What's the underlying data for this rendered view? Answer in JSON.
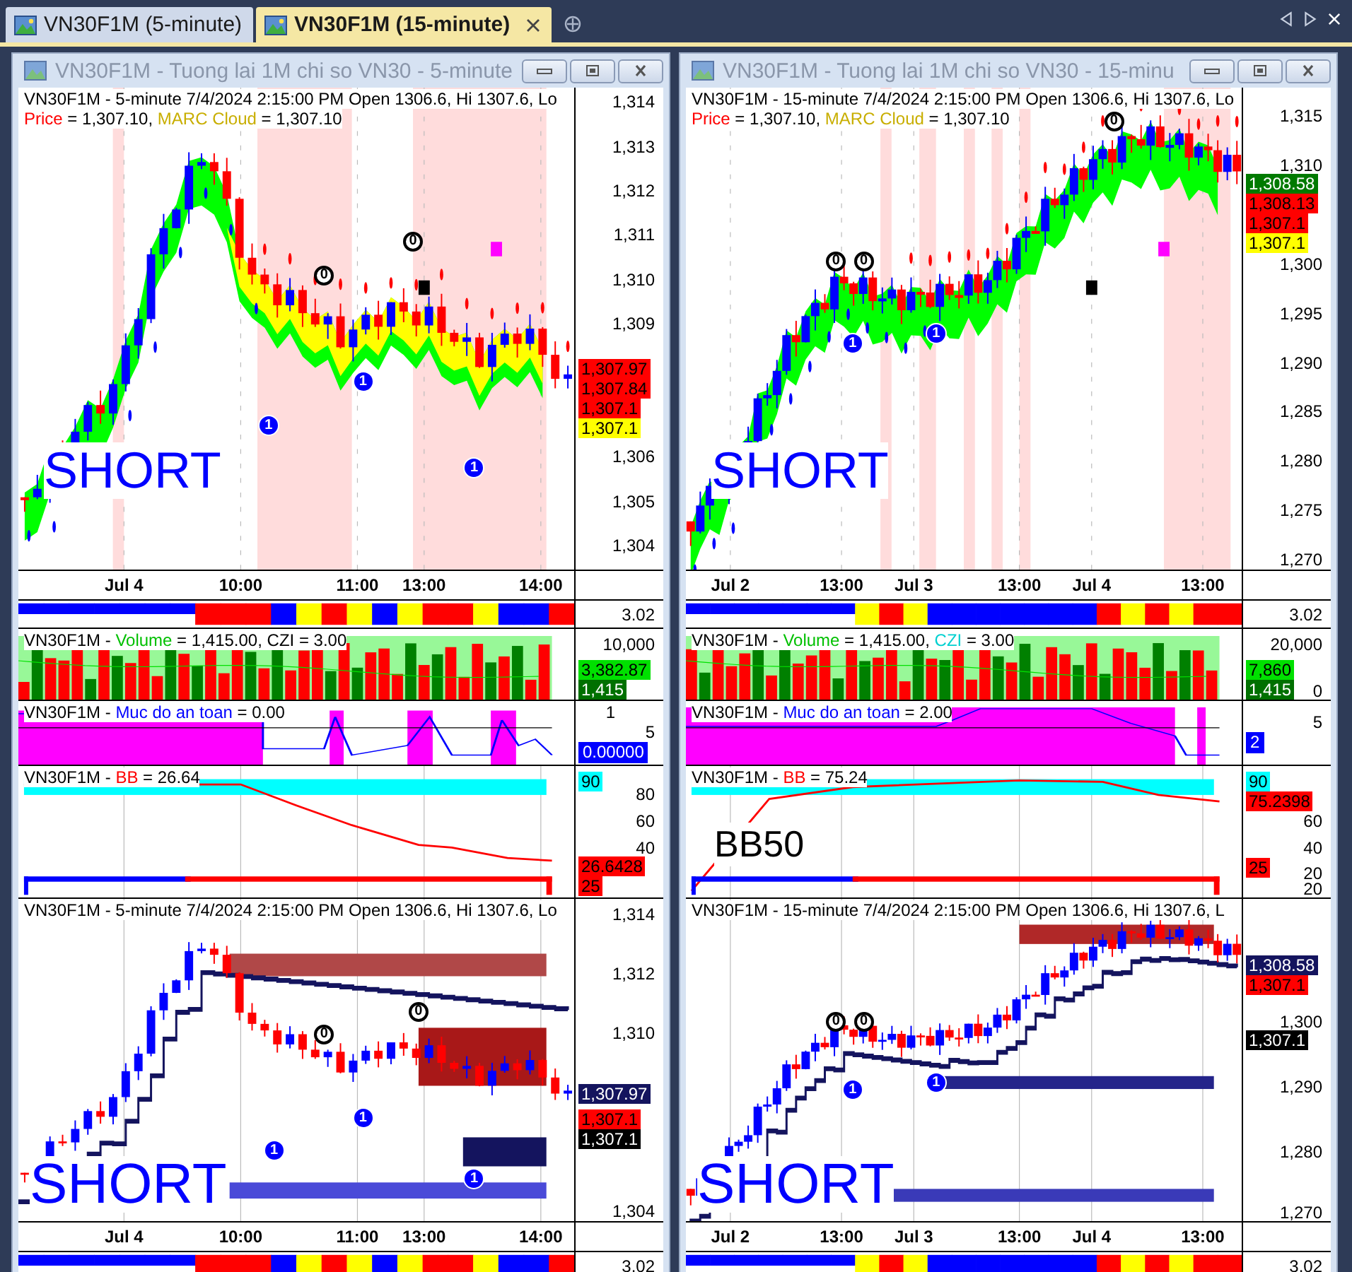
{
  "tabs": [
    {
      "label": "VN30F1M (5-minute)",
      "selected": false
    },
    {
      "label": "VN30F1M (15-minute)",
      "selected": true
    }
  ],
  "windows": [
    {
      "title": "VN30F1M - Tuong lai 1M chi so VN30 - 5-minute",
      "panes": [
        {
          "kind": "price_cloud",
          "legend": [
            [
              {
                "text": "VN30F1M - 5-minute 7/4/2024 2:15:00 PM Open 1306.6, Hi 1307.6, Lo"
              }
            ],
            [
              {
                "text": "Price",
                "color": "#ff0000"
              },
              {
                "text": " = 1,307.10, "
              },
              {
                "text": "MARC Cloud",
                "color": "#c8ae00"
              },
              {
                "text": " = 1,307.10"
              }
            ]
          ],
          "markers": [
            {
              "text": "1",
              "kind": "bottom"
            },
            {
              "text": "0",
              "kind": "top"
            },
            {
              "text": "1",
              "kind": "bottom"
            },
            {
              "text": "0",
              "kind": "top"
            },
            {
              "text": "1",
              "kind": "bottom"
            }
          ],
          "signal": "SHORT",
          "yticks": [
            "1,314",
            "1,313",
            "1,312",
            "1,311",
            "1,310",
            "1,309",
            "1,306",
            "1,305",
            "1,304"
          ],
          "tags": [
            {
              "text": "1,307.97",
              "color": "#ff0000"
            },
            {
              "text": "1,307.84",
              "color": "#ff0000"
            },
            {
              "text": "1,307.1",
              "color": "#ff0000"
            },
            {
              "text": "1,307.1",
              "color": "#ffff00"
            }
          ],
          "xticks": [
            "Jul 4",
            "10:00",
            "11:00",
            "13:00",
            "14:00"
          ]
        },
        {
          "kind": "ribbon",
          "yticks": [
            "3.02"
          ]
        },
        {
          "kind": "volume",
          "legend": [
            [
              {
                "text": "VN30F1M - "
              },
              {
                "text": "Volume",
                "color": "#00c000"
              },
              {
                "text": " = 1,415.00, CZI = 3.00"
              }
            ]
          ],
          "yticks": [
            "10,000"
          ],
          "tags": [
            {
              "text": "3,382.87",
              "color": "#00e000"
            },
            {
              "text": "1,415",
              "color": "#007000"
            }
          ]
        },
        {
          "kind": "safety",
          "legend": [
            [
              {
                "text": "VN30F1M - "
              },
              {
                "text": "Muc do an toan",
                "color": "#0000ff"
              },
              {
                "text": " = 0.00"
              }
            ]
          ],
          "yticks": [
            "1",
            "5"
          ],
          "tags": [
            {
              "text": "0.00000",
              "color": "#0000ff"
            }
          ]
        },
        {
          "kind": "bb",
          "legend": [
            [
              {
                "text": "VN30F1M - "
              },
              {
                "text": "BB",
                "color": "#ff0000"
              },
              {
                "text": " = 26.64"
              }
            ]
          ],
          "yticks": [
            "80",
            "60",
            "40"
          ],
          "tags": [
            {
              "text": "90",
              "color": "#00ffff"
            },
            {
              "text": "26.6428",
              "color": "#ff0000"
            },
            {
              "text": "25",
              "color": "#ff0000"
            }
          ]
        },
        {
          "kind": "price_stop",
          "legend": [
            [
              {
                "text": "VN30F1M - 5-minute 7/4/2024 2:15:00 PM Open 1306.6, Hi 1307.6, Lo"
              }
            ]
          ],
          "markers": [
            {
              "text": "1",
              "kind": "bottom"
            },
            {
              "text": "0",
              "kind": "top"
            },
            {
              "text": "1",
              "kind": "bottom"
            },
            {
              "text": "0",
              "kind": "top"
            },
            {
              "text": "1",
              "kind": "bottom"
            }
          ],
          "signal": "SHORT",
          "yticks": [
            "1,314",
            "1,312",
            "1,310",
            "1,304"
          ],
          "tags": [
            {
              "text": "1,307.97",
              "color": "#14145e"
            },
            {
              "text": "1,307.1",
              "color": "#ff0000"
            },
            {
              "text": "1,307.1",
              "color": "#000000"
            }
          ],
          "xticks": [
            "Jul 4",
            "10:00",
            "11:00",
            "13:00",
            "14:00"
          ]
        },
        {
          "kind": "ribbon",
          "yticks": [
            "3.02"
          ]
        }
      ]
    },
    {
      "title": "VN30F1M - Tuong lai 1M chi so VN30 - 15-minu",
      "panes": [
        {
          "kind": "price_cloud",
          "legend": [
            [
              {
                "text": "VN30F1M - 15-minute 7/4/2024 2:15:00 PM Open 1306.6, Hi 1307.6, Lo"
              }
            ],
            [
              {
                "text": "Price",
                "color": "#ff0000"
              },
              {
                "text": " = 1,307.10, "
              },
              {
                "text": "MARC Cloud",
                "color": "#c8ae00"
              },
              {
                "text": " = 1,307.10"
              }
            ]
          ],
          "markers": [
            {
              "text": "0",
              "kind": "top"
            },
            {
              "text": "1",
              "kind": "bottom"
            },
            {
              "text": "0",
              "kind": "top"
            },
            {
              "text": "1",
              "kind": "bottom"
            },
            {
              "text": "0",
              "kind": "top"
            }
          ],
          "signal": "SHORT",
          "yticks": [
            "1,315",
            "1,310",
            "1,300",
            "1,295",
            "1,290",
            "1,285",
            "1,280",
            "1,275",
            "1,270"
          ],
          "tags": [
            {
              "text": "1,308.58",
              "color": "#007a00"
            },
            {
              "text": "1,308.13",
              "color": "#ff0000"
            },
            {
              "text": "1,307.1",
              "color": "#ff0000"
            },
            {
              "text": "1,307.1",
              "color": "#ffff00"
            }
          ],
          "xticks": [
            "Jul 2",
            "13:00",
            "Jul 3",
            "13:00",
            "Jul 4",
            "13:00"
          ]
        },
        {
          "kind": "ribbon",
          "yticks": [
            "3.02"
          ]
        },
        {
          "kind": "volume",
          "legend": [
            [
              {
                "text": "VN30F1M - "
              },
              {
                "text": "Volume",
                "color": "#00c000"
              },
              {
                "text": " = 1,415.00, "
              },
              {
                "text": "CZI",
                "color": "#00d0d0"
              },
              {
                "text": " = 3.00"
              }
            ]
          ],
          "yticks": [
            "20,000",
            "0"
          ],
          "tags": [
            {
              "text": "7,860",
              "color": "#00e000"
            },
            {
              "text": "1,415",
              "color": "#007000"
            }
          ]
        },
        {
          "kind": "safety",
          "legend": [
            [
              {
                "text": "VN30F1M - "
              },
              {
                "text": "Muc do an toan",
                "color": "#0000ff"
              },
              {
                "text": " = 2.00"
              }
            ]
          ],
          "yticks": [
            "5"
          ],
          "tags": [
            {
              "text": "2",
              "color": "#0000ff"
            }
          ]
        },
        {
          "kind": "bb",
          "legend": [
            [
              {
                "text": "VN30F1M - "
              },
              {
                "text": "BB",
                "color": "#ff0000"
              },
              {
                "text": " = 75.24"
              }
            ]
          ],
          "label": "BB50",
          "yticks": [
            "60",
            "40",
            "20",
            "20"
          ],
          "tags": [
            {
              "text": "90",
              "color": "#00ffff"
            },
            {
              "text": "75.2398",
              "color": "#ff0000"
            },
            {
              "text": "25",
              "color": "#ff0000"
            }
          ]
        },
        {
          "kind": "price_stop",
          "legend": [
            [
              {
                "text": "VN30F1M - 15-minute 7/4/2024 2:15:00 PM Open 1306.6, Hi 1307.6, L"
              }
            ]
          ],
          "markers": [
            {
              "text": "0",
              "kind": "top"
            },
            {
              "text": "1",
              "kind": "bottom"
            },
            {
              "text": "0",
              "kind": "top"
            },
            {
              "text": "1",
              "kind": "bottom"
            }
          ],
          "signal": "SHORT",
          "yticks": [
            "1,300",
            "1,290",
            "1,280",
            "1,270"
          ],
          "tags": [
            {
              "text": "1,308.58",
              "color": "#14145e"
            },
            {
              "text": "1,307.1",
              "color": "#ff0000"
            },
            {
              "text": "1,307.1",
              "color": "#000000"
            }
          ],
          "xticks": [
            "Jul 2",
            "13:00",
            "Jul 3",
            "13:00",
            "Jul 4",
            "13:00"
          ]
        },
        {
          "kind": "ribbon",
          "yticks": [
            "3.02"
          ]
        }
      ]
    }
  ]
}
